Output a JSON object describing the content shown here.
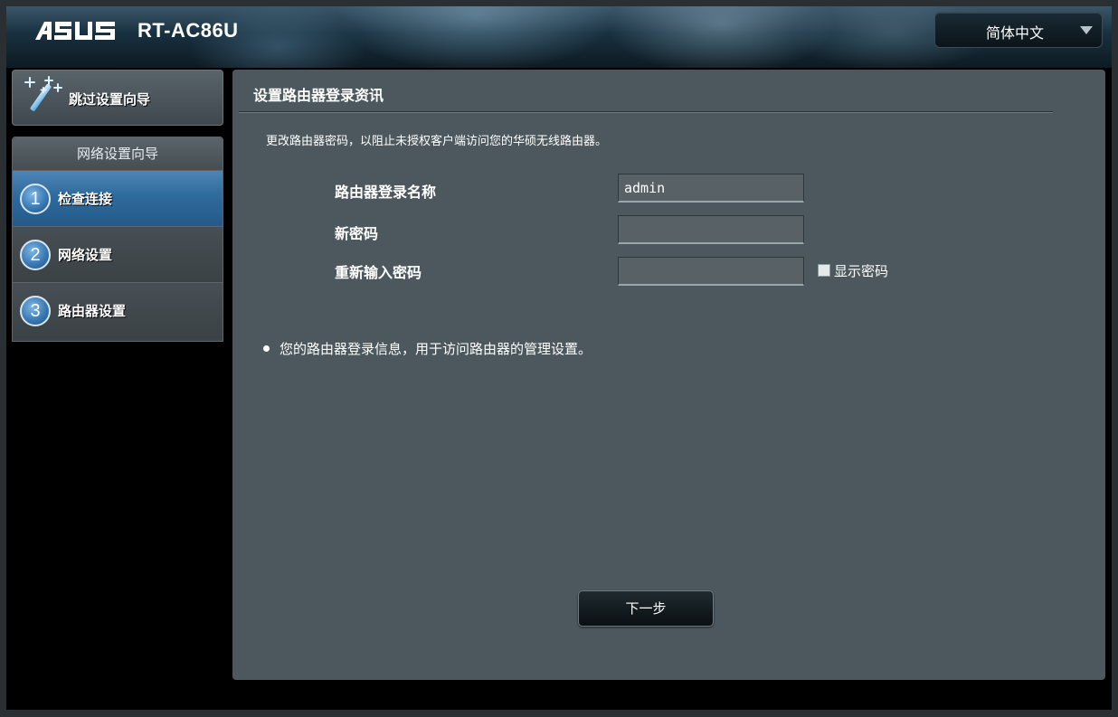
{
  "header": {
    "brand": "ASUS",
    "model": "RT-AC86U",
    "language": {
      "selected": "简体中文"
    }
  },
  "sidebar": {
    "skip_wizard_label": "跳过设置向导",
    "wizard_title": "网络设置向导",
    "steps": [
      {
        "number": "1",
        "label": "检查连接",
        "active": true
      },
      {
        "number": "2",
        "label": "网络设置",
        "active": false
      },
      {
        "number": "3",
        "label": "路由器设置",
        "active": false
      }
    ]
  },
  "main": {
    "title": "设置路由器登录资讯",
    "description": "更改路由器密码，以阻止未授权客户端访问您的华硕无线路由器。",
    "form": {
      "username_label": "路由器登录名称",
      "username_value": "admin",
      "new_password_label": "新密码",
      "new_password_value": "",
      "confirm_password_label": "重新输入密码",
      "confirm_password_value": "",
      "show_password_label": "显示密码",
      "show_password_checked": false
    },
    "note": "您的路由器登录信息，用于访问路由器的管理设置。",
    "next_button_label": "下一步"
  },
  "colors": {
    "content_bg": "#4d585e",
    "active_step": "#2f6a9c",
    "page_bg": "#000000"
  }
}
